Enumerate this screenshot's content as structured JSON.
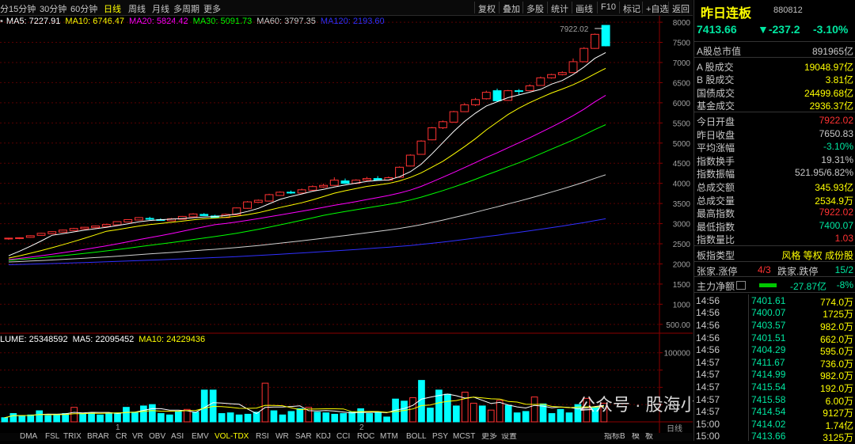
{
  "toolbar": {
    "periods": [
      {
        "label": "分",
        "active": false
      },
      {
        "label": "15分钟",
        "active": false
      },
      {
        "label": "30分钟",
        "active": false
      },
      {
        "label": "60分钟",
        "active": false
      },
      {
        "label": "日线",
        "active": true
      },
      {
        "label": "周线",
        "active": false
      },
      {
        "label": "月线",
        "active": false
      },
      {
        "label": "多周期",
        "active": false
      },
      {
        "label": "更多",
        "active": false
      }
    ],
    "tools": [
      "复权",
      "叠加",
      "多股",
      "统计",
      "画线",
      "F10",
      "标记",
      "+自选",
      "返回"
    ]
  },
  "ma_legend": [
    {
      "label": "MA5: 7227.91",
      "color": "#ffffff"
    },
    {
      "label": "MA10: 6746.47",
      "color": "#ffff00"
    },
    {
      "label": "MA20: 5824.42",
      "color": "#ff00ff"
    },
    {
      "label": "MA30: 5091.73",
      "color": "#00ff00"
    },
    {
      "label": "MA60: 3797.35",
      "color": "#d0d0d0"
    },
    {
      "label": "MA120: 2193.60",
      "color": "#3030ff"
    }
  ],
  "vol_legend": [
    {
      "label": "LUME: 25348592",
      "color": "#ffffff"
    },
    {
      "label": "MA5: 22095452",
      "color": "#ffffff"
    },
    {
      "label": "MA10: 24229436",
      "color": "#ffff00"
    }
  ],
  "chart_data": {
    "type": "candlestick",
    "price_axis": {
      "ticks": [
        500,
        1000,
        1500,
        2000,
        2500,
        3000,
        3500,
        4000,
        4500,
        5000,
        5500,
        6000,
        6500,
        7000,
        7500,
        8000
      ],
      "labels": [
        "500.00",
        "1000",
        "1500",
        "2000",
        "2500",
        "3000",
        "3500",
        "4000",
        "4500",
        "5000",
        "5500",
        "6000",
        "6500",
        "7000",
        "7500",
        "8000"
      ],
      "range": [
        300,
        8080
      ]
    },
    "volume_axis": {
      "ticks": [
        25000,
        50000,
        75000,
        100000
      ],
      "labels": [
        "",
        "",
        "",
        "100000"
      ],
      "range": [
        0,
        110000
      ]
    },
    "candles_note": "",
    "candles": [
      [
        2620,
        2640,
        2600,
        2650
      ],
      [
        2630,
        2650,
        2615,
        2660
      ],
      [
        2660,
        2700,
        2650,
        2710
      ],
      [
        2710,
        2760,
        2700,
        2770
      ],
      [
        2750,
        2800,
        2740,
        2810
      ],
      [
        2790,
        2840,
        2780,
        2850
      ],
      [
        2830,
        2880,
        2820,
        2895
      ],
      [
        2870,
        2910,
        2860,
        2920
      ],
      [
        2900,
        2940,
        2890,
        2950
      ],
      [
        2930,
        2980,
        2920,
        3000
      ],
      [
        2970,
        3050,
        2960,
        3060
      ],
      [
        3040,
        3100,
        3030,
        3110
      ],
      [
        3090,
        3150,
        3080,
        3160
      ],
      [
        3130,
        3110,
        3090,
        3170
      ],
      [
        3100,
        3080,
        3070,
        3130
      ],
      [
        3070,
        3120,
        3060,
        3140
      ],
      [
        3110,
        3180,
        3100,
        3190
      ],
      [
        3170,
        3240,
        3160,
        3260
      ],
      [
        3230,
        3200,
        3190,
        3260
      ],
      [
        3190,
        3150,
        3140,
        3220
      ],
      [
        3150,
        3230,
        3140,
        3250
      ],
      [
        3220,
        3390,
        3210,
        3400
      ],
      [
        3380,
        3540,
        3370,
        3560
      ],
      [
        3530,
        3580,
        3520,
        3600
      ],
      [
        3560,
        3720,
        3550,
        3740
      ],
      [
        3700,
        3780,
        3690,
        3800
      ],
      [
        3780,
        3760,
        3740,
        3820
      ],
      [
        3760,
        3840,
        3750,
        3870
      ],
      [
        3830,
        3920,
        3820,
        3950
      ],
      [
        3910,
        3950,
        3890,
        3990
      ],
      [
        3950,
        4080,
        3940,
        4150
      ],
      [
        4060,
        4000,
        3990,
        4120
      ],
      [
        4000,
        4080,
        3980,
        4100
      ],
      [
        4080,
        4120,
        4060,
        4160
      ],
      [
        4120,
        4080,
        4070,
        4180
      ],
      [
        4080,
        4140,
        4070,
        4170
      ],
      [
        4150,
        4400,
        4140,
        4420
      ],
      [
        4430,
        4700,
        4420,
        4720
      ],
      [
        4720,
        5050,
        4710,
        5070
      ],
      [
        5080,
        5380,
        5070,
        5400
      ],
      [
        5380,
        5530,
        5350,
        5560
      ],
      [
        5520,
        5780,
        5510,
        5800
      ],
      [
        5780,
        5950,
        5770,
        5990
      ],
      [
        5950,
        6080,
        5920,
        6120
      ],
      [
        6100,
        6260,
        6080,
        6300
      ],
      [
        6300,
        6050,
        6040,
        6350
      ],
      [
        6060,
        6300,
        6050,
        6320
      ],
      [
        6300,
        6280,
        6200,
        6340
      ],
      [
        6300,
        6420,
        6290,
        6460
      ],
      [
        6430,
        6620,
        6420,
        6650
      ],
      [
        6620,
        6700,
        6600,
        6720
      ],
      [
        6700,
        6750,
        6680,
        6780
      ],
      [
        6750,
        7020,
        6740,
        7100
      ],
      [
        7020,
        7350,
        7010,
        7380
      ],
      [
        7350,
        7700,
        7340,
        7720
      ],
      [
        7922.02,
        7413.66,
        7400.07,
        7922.02
      ]
    ],
    "volumes": [
      [
        6000,
        "c"
      ],
      [
        12000,
        "c"
      ],
      [
        9000,
        "c"
      ],
      [
        10000,
        "c"
      ],
      [
        16000,
        "c"
      ],
      [
        9000,
        "c"
      ],
      [
        11000,
        "c"
      ],
      [
        12000,
        "c"
      ],
      [
        21000,
        "r"
      ],
      [
        12000,
        "c"
      ],
      [
        13000,
        "c"
      ],
      [
        10000,
        "c"
      ],
      [
        12000,
        "c"
      ],
      [
        13000,
        "c"
      ],
      [
        21000,
        "c"
      ],
      [
        14000,
        "c"
      ],
      [
        23000,
        "c"
      ],
      [
        25000,
        "c"
      ],
      [
        12000,
        "c"
      ],
      [
        10000,
        "c"
      ],
      [
        15000,
        "c"
      ],
      [
        18000,
        "r"
      ],
      [
        14000,
        "c"
      ],
      [
        46000,
        "c"
      ],
      [
        46000,
        "c"
      ],
      [
        12000,
        "c"
      ],
      [
        13000,
        "c"
      ],
      [
        10000,
        "c"
      ],
      [
        11000,
        "c"
      ],
      [
        14000,
        "c"
      ],
      [
        56000,
        "r"
      ],
      [
        16000,
        "c"
      ],
      [
        10000,
        "c"
      ],
      [
        15000,
        "c"
      ],
      [
        19000,
        "c"
      ],
      [
        21000,
        "r"
      ],
      [
        14000,
        "c"
      ],
      [
        13000,
        "c"
      ],
      [
        11000,
        "c"
      ],
      [
        12000,
        "c"
      ],
      [
        14000,
        "c"
      ],
      [
        19000,
        "c"
      ],
      [
        12000,
        "c"
      ],
      [
        14000,
        "c"
      ],
      [
        7000,
        "c"
      ],
      [
        33000,
        "c"
      ],
      [
        30000,
        "c"
      ],
      [
        35000,
        "r"
      ],
      [
        60000,
        "c"
      ],
      [
        20000,
        "c"
      ],
      [
        46000,
        "c"
      ],
      [
        40000,
        "c"
      ],
      [
        23000,
        "c"
      ],
      [
        43000,
        "r"
      ],
      [
        27000,
        "r"
      ],
      [
        23000,
        "c"
      ],
      [
        17000,
        "r"
      ],
      [
        31000,
        "r"
      ],
      [
        24000,
        "c"
      ],
      [
        13000,
        "c"
      ],
      [
        15000,
        "c"
      ],
      [
        36000,
        "r"
      ],
      [
        26000,
        "c"
      ],
      [
        12000,
        "c"
      ],
      [
        18000,
        "c"
      ],
      [
        13000,
        "c"
      ],
      [
        25000,
        "c"
      ],
      [
        34000,
        "r"
      ],
      [
        21000,
        "c"
      ],
      [
        27000,
        "r"
      ]
    ],
    "peak_label": "7922.02",
    "colors": {
      "up": "#ff3232",
      "down": "#00ffff"
    }
  },
  "bottom_tabs": [
    "DMA",
    "FSL",
    "TRIX",
    "BRAR",
    "CR",
    "VR",
    "OBV",
    "ASI",
    "EMV",
    "VOL-TDX",
    "RSI",
    "WR",
    "SAR",
    "KDJ",
    "CCI",
    "ROC",
    "MTM",
    "BOLL",
    "PSY",
    "MCST",
    "更多",
    "设置"
  ],
  "bottom_tab_active": "VOL-TDX",
  "bottom_marks": [
    "1",
    "2"
  ],
  "bottom_right_labels": [
    "指标B",
    "模",
    "板"
  ],
  "panel": {
    "title": "昨日连板",
    "code": "880812",
    "price": "7413.66",
    "change": "▼-237.2",
    "change_pct": "-3.10%",
    "stats_a": [
      {
        "k": "A股总市值",
        "v": "891965亿",
        "c": "#c8c8c8"
      }
    ],
    "stats_b": [
      {
        "k": "A 股成交",
        "v": "19048.97亿",
        "c": "#ffff00"
      },
      {
        "k": "B 股成交",
        "v": "3.81亿",
        "c": "#ffff00"
      },
      {
        "k": "国债成交",
        "v": "24499.68亿",
        "c": "#ffff00"
      },
      {
        "k": "基金成交",
        "v": "2936.37亿",
        "c": "#ffff00"
      }
    ],
    "stats_c": [
      {
        "k": "今日开盘",
        "v": "7922.02",
        "c": "#ff3232"
      },
      {
        "k": "昨日收盘",
        "v": "7650.83",
        "c": "#c8c8c8"
      },
      {
        "k": "平均涨幅",
        "v": "-3.10%",
        "c": "#00e6a0"
      },
      {
        "k": "指数换手",
        "v": "19.31%",
        "c": "#c8c8c8"
      },
      {
        "k": "指数振幅",
        "v": "521.95/6.82%",
        "c": "#c8c8c8"
      },
      {
        "k": "总成交额",
        "v": "345.93亿",
        "c": "#ffff00"
      },
      {
        "k": "总成交量",
        "v": "2534.9万",
        "c": "#ffff00"
      },
      {
        "k": "最高指数",
        "v": "7922.02",
        "c": "#ff3232"
      },
      {
        "k": "最低指数",
        "v": "7400.07",
        "c": "#00e6a0"
      },
      {
        "k": "指数量比",
        "v": "1.03",
        "c": "#ff3232"
      }
    ],
    "type_row": {
      "k": "板指类型",
      "v": "风格 等权 成份股"
    },
    "updown_row": {
      "k1": "张家.涨停",
      "v1": "4/3",
      "k2": "跌家.跌停",
      "v2": "15/2"
    },
    "flow_row": {
      "k": "主力净额",
      "v1": "-27.87亿",
      "v2": "-8%"
    },
    "ticks": [
      {
        "t": "14:56",
        "p": "7401.61",
        "a": "774.0万"
      },
      {
        "t": "14:56",
        "p": "7400.07",
        "a": "1725万"
      },
      {
        "t": "14:56",
        "p": "7403.57",
        "a": "982.0万"
      },
      {
        "t": "14:56",
        "p": "7401.51",
        "a": "662.0万"
      },
      {
        "t": "14:56",
        "p": "7404.29",
        "a": "595.0万"
      },
      {
        "t": "14:57",
        "p": "7411.67",
        "a": "736.0万"
      },
      {
        "t": "14:57",
        "p": "7414.99",
        "a": "982.0万"
      },
      {
        "t": "14:57",
        "p": "7415.54",
        "a": "192.0万"
      },
      {
        "t": "14:57",
        "p": "7415.58",
        "a": "6.00万"
      },
      {
        "t": "14:57",
        "p": "7414.54",
        "a": "9127万"
      },
      {
        "t": "15:00",
        "p": "7414.02",
        "a": "1.74亿"
      },
      {
        "t": "15:00",
        "p": "7413.66",
        "a": "3125万"
      }
    ]
  },
  "watermark": "公众号 · 股海小水手"
}
